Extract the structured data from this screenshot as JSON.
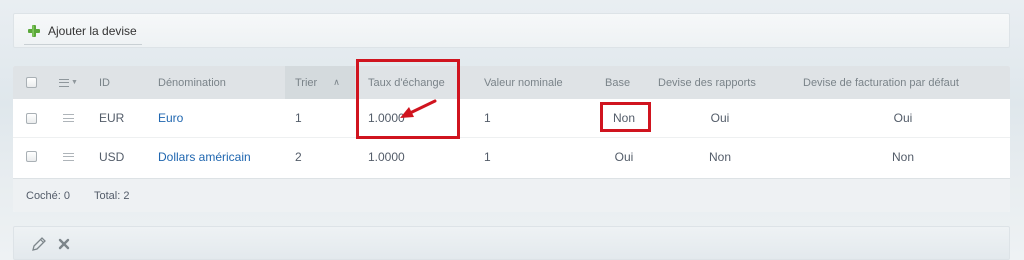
{
  "toolbar": {
    "add_label": "Ajouter la devise",
    "add_icon": "plus-icon"
  },
  "grid": {
    "columns": {
      "id": "ID",
      "name": "Dénomination",
      "sort": "Trier",
      "rate": "Taux d'échange",
      "nominal": "Valeur nominale",
      "base": "Base",
      "reports": "Devise des rapports",
      "billing": "Devise de facturation par défaut"
    },
    "rows": [
      {
        "id": "EUR",
        "name": "Euro",
        "sort": "1",
        "rate": "1.0000",
        "nominal": "1",
        "base": "Non",
        "reports": "Oui",
        "billing": "Oui"
      },
      {
        "id": "USD",
        "name": "Dollars américain",
        "sort": "2",
        "rate": "1.0000",
        "nominal": "1",
        "base": "Oui",
        "reports": "Non",
        "billing": "Non"
      }
    ],
    "footer": {
      "checked": "Coché: 0",
      "total": "Total: 2"
    }
  },
  "colors": {
    "highlight": "#d0141f",
    "link": "#2067b0",
    "header_bg": "#dfe3e6"
  },
  "bottom_toolbar": {
    "icons": [
      "pencil-icon",
      "delete-icon"
    ]
  }
}
